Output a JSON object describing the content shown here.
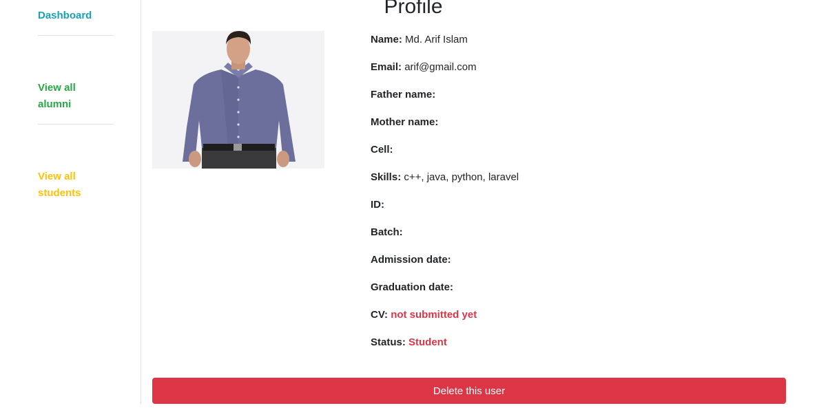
{
  "sidebar": {
    "dashboard": "Dashboard",
    "view_all_alumni": "View all alumni",
    "view_all_students": "View all students"
  },
  "page": {
    "title": "Profile"
  },
  "profile": {
    "photo_icon": "person-photo",
    "fields": [
      {
        "label": "Name:",
        "value": "Md. Arif Islam"
      },
      {
        "label": "Email:",
        "value": "arif@gmail.com"
      },
      {
        "label": "Father name:",
        "value": ""
      },
      {
        "label": "Mother name:",
        "value": ""
      },
      {
        "label": "Cell:",
        "value": ""
      },
      {
        "label": "Skills:",
        "value": "c++, java, python, laravel"
      },
      {
        "label": "ID:",
        "value": ""
      },
      {
        "label": "Batch:",
        "value": ""
      },
      {
        "label": "Admission date:",
        "value": ""
      },
      {
        "label": "Graduation date:",
        "value": ""
      },
      {
        "label": "CV:",
        "value": "not submitted yet"
      },
      {
        "label": "Status:",
        "value": "Student"
      }
    ]
  },
  "actions": {
    "delete": "Delete this user"
  },
  "colors": {
    "dashboard": "#17a2b8",
    "alumni": "#28a745",
    "students": "#ffc107",
    "danger": "#dc3545"
  }
}
